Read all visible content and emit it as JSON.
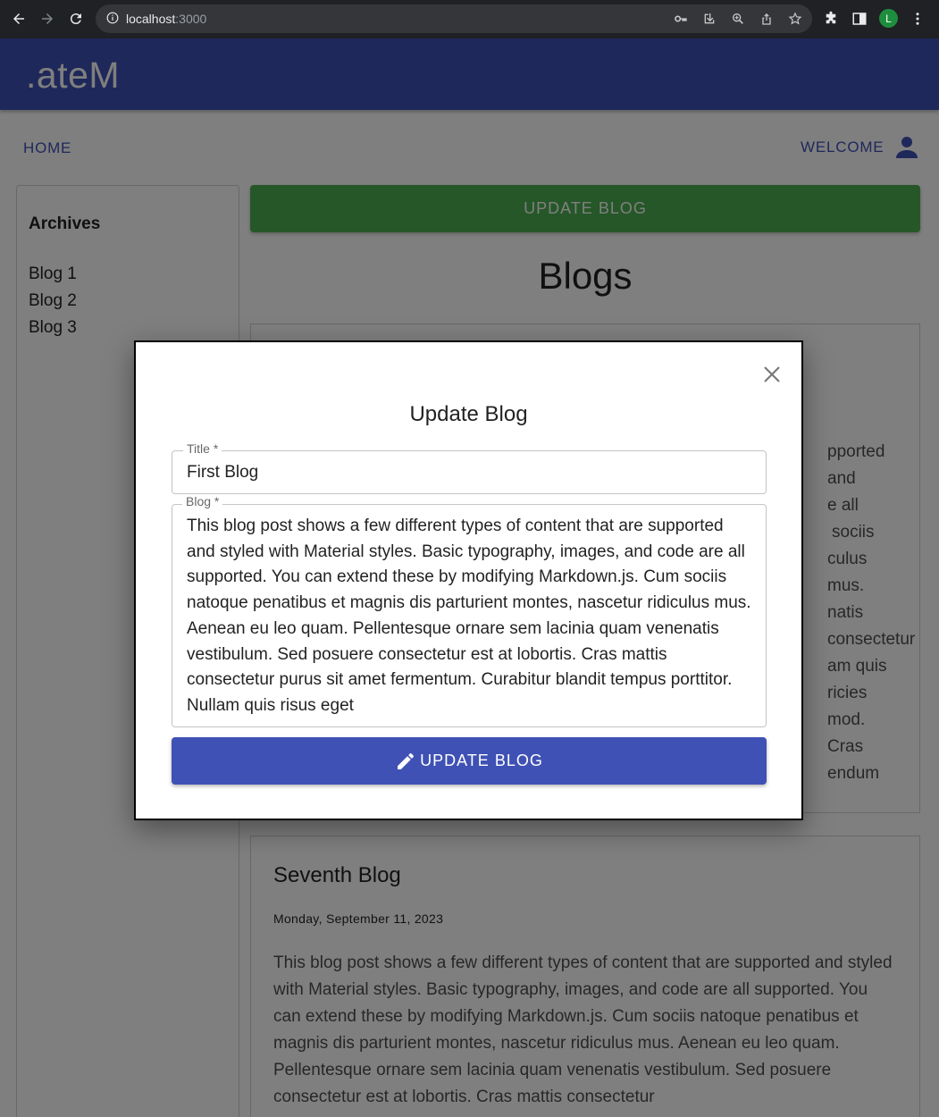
{
  "browser": {
    "url_host": "localhost",
    "url_port": ":3000",
    "profile_initial": "L"
  },
  "app": {
    "brand": ".ateM",
    "nav_home": "HOME",
    "welcome": "WELCOME",
    "update_blog_button": "UPDATE BLOG",
    "blogs_heading": "Blogs"
  },
  "sidebar": {
    "title": "Archives",
    "items": [
      {
        "label": "Blog 1"
      },
      {
        "label": "Blog 2"
      },
      {
        "label": "Blog 3"
      }
    ]
  },
  "posts": [
    {
      "body_lines": [
        "pported and",
        "e all",
        "sociis",
        "culus mus.",
        "natis",
        "consectetur",
        "am quis",
        "ricies",
        "mod. Cras",
        "endum"
      ]
    },
    {
      "title": "Seventh Blog",
      "date": "Monday, September 11, 2023",
      "body": "This blog post shows a few different types of content that are supported and styled with Material styles. Basic typography, images, and code are all supported. You can extend these by modifying Markdown.js. Cum sociis natoque penatibus et magnis dis parturient montes, nascetur ridiculus mus. Aenean eu leo quam. Pellentesque ornare sem lacinia quam venenatis vestibulum. Sed posuere consectetur est at lobortis. Cras mattis consectetur"
    }
  ],
  "modal": {
    "title": "Update Blog",
    "title_label": "Title *",
    "title_value": "First Blog",
    "blog_label": "Blog *",
    "blog_value": "This blog post shows a few different types of content that are supported and styled with Material styles. Basic typography, images, and code are all supported. You can extend these by modifying Markdown.js. Cum sociis natoque penatibus et magnis dis parturient montes, nascetur ridiculus mus. Aenean eu leo quam. Pellentesque ornare sem lacinia quam venenatis vestibulum. Sed posuere consectetur est at lobortis. Cras mattis consectetur purus sit amet fermentum. Curabitur blandit tempus porttitor. Nullam quis risus eget",
    "submit_label": "UPDATE BLOG"
  },
  "colors": {
    "primary": "#3f51b5",
    "success": "#4caf50",
    "browser_bg": "#202124"
  }
}
